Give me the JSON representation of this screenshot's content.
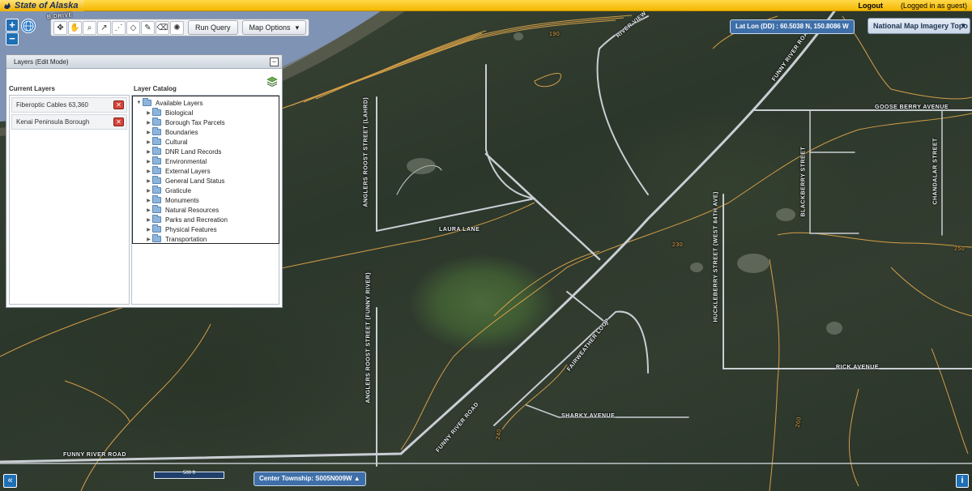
{
  "header": {
    "brand": "State of Alaska",
    "logout_label": "Logout",
    "login_status": "(Logged in as guest)"
  },
  "toolbar": {
    "run_query_label": "Run Query",
    "map_options_label": "Map Options",
    "tools": [
      "pan-icon",
      "hand-icon",
      "zoom-icon",
      "identify-icon",
      "measure-line-icon",
      "measure-area-icon",
      "draw-icon",
      "eraser-icon",
      "settings-icon"
    ]
  },
  "zoom": {
    "in_label": "+",
    "out_label": "−"
  },
  "coords": {
    "label": "Lat Lon (DD) :",
    "value": "60.5038 N, 150.8086 W"
  },
  "basemap": {
    "selected": "National Map Imagery Topo"
  },
  "layers_panel": {
    "title": "Layers (Edit Mode)",
    "current_title": "Current Layers",
    "catalog_title": "Layer Catalog",
    "current_layers": [
      "Fiberoptic Cables 63,360",
      "Kenai Peninsula Borough"
    ],
    "catalog_root": "Available Layers",
    "catalog_items": [
      "Biological",
      "Borough Tax Parcels",
      "Boundaries",
      "Cultural",
      "DNR Land Records",
      "Environmental",
      "External Layers",
      "General Land Status",
      "Graticule",
      "Monuments",
      "Natural Resources",
      "Parks and Recreation",
      "Physical Features",
      "Transportation"
    ]
  },
  "map_labels": {
    "river_view": "RIVER VIEW TR",
    "funny_river_road_ne": "FUNNY RIVER ROAD",
    "goose_berry": "GOOSE BERRY AVENUE",
    "anglers_north": "ANGLERS ROOST STREET (LAHRD)",
    "laura_lane": "LAURA LANE",
    "blackberry": "BLACKBERRY STREET",
    "chandalar": "CHANDALAR STREET",
    "huckleberry": "HUCKLEBERRY STREET (WEST 84TH AVE)",
    "anglers_south": "ANGLERS ROOST STREET (FUNNY RIVER)",
    "fairweather": "FAIRWEATHER LOOP",
    "rick_avenue": "RICK AVENUE",
    "funny_river_road_sw": "FUNNY RIVER ROAD",
    "sharky": "SHARKY AVENUE",
    "funny_river_road_w": "FUNNY RIVER ROAD",
    "drive_partial": "B   DRIVE",
    "contour_190": "190",
    "contour_250": "250",
    "contour_230": "230",
    "contour_240": "240",
    "contour_260": "260"
  },
  "footer": {
    "nav_label": "«",
    "scale_label": "500 ft",
    "township_label": "Center Township:",
    "township_value": "S005N009W",
    "info_label": "i"
  },
  "colors": {
    "brand_bar": "#f5b800",
    "accent_blue": "#1f6fb5",
    "contour": "#e6a94a",
    "road": "#c9ced4",
    "water": "#7f93b5"
  }
}
